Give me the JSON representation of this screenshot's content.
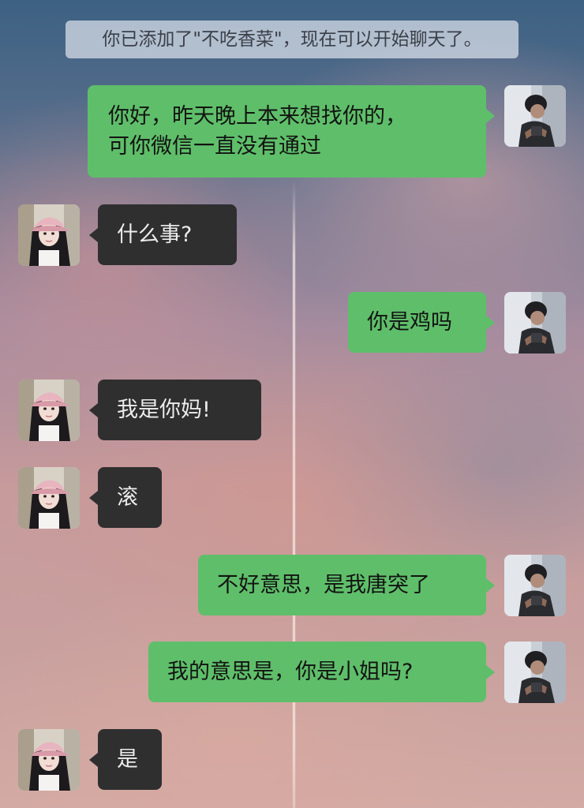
{
  "chat": {
    "system_notice": "你已添加了\"不吃香菜\"，现在可以开始聊天了。",
    "messages": [
      {
        "sender": "me",
        "text": "你好，昨天晚上本来想找你的，\n可你微信一直没有通过"
      },
      {
        "sender": "contact",
        "text": "什么事?"
      },
      {
        "sender": "me",
        "text": "你是鸡吗"
      },
      {
        "sender": "contact",
        "text": "我是你妈!"
      },
      {
        "sender": "contact",
        "text": "滚"
      },
      {
        "sender": "me",
        "text": "不好意思，是我唐突了"
      },
      {
        "sender": "me",
        "text": "我的意思是，你是小姐吗?"
      },
      {
        "sender": "contact",
        "text": "是"
      }
    ]
  },
  "colors": {
    "outgoing_bubble": "#5fbe6a",
    "incoming_bubble": "#2f2f30",
    "system_notice_bg": "#dce2ec"
  },
  "icons": {
    "my_avatar": "avatar-man-photo",
    "contact_avatar": "avatar-girl-with-cap-photo"
  }
}
